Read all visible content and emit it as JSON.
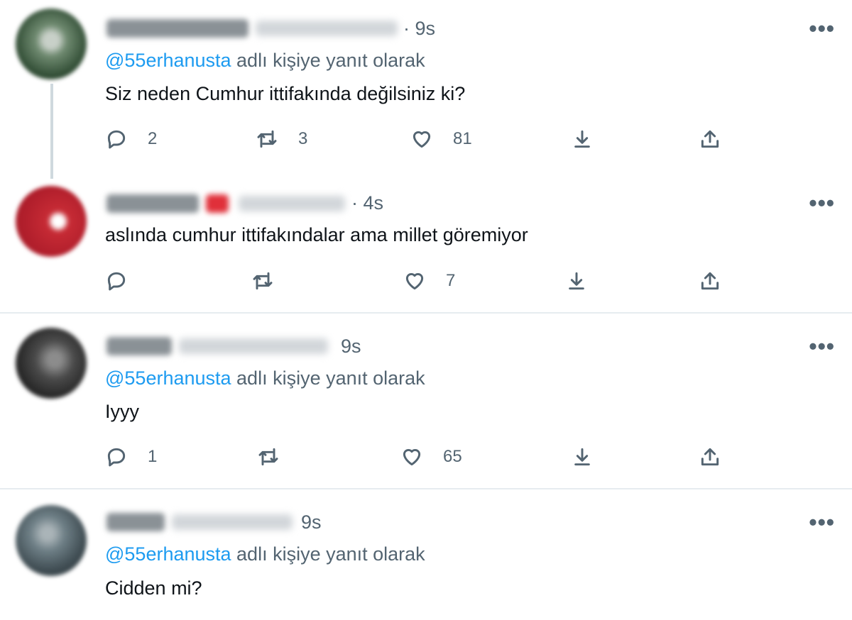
{
  "more_label": "•••",
  "icons": {
    "reply": "reply-icon",
    "retweet": "retweet-icon",
    "like": "like-icon",
    "download": "download-icon",
    "share": "share-icon"
  },
  "colors": {
    "mention": "#1d9bf0",
    "secondary": "#536471",
    "divider": "#e6ecf0"
  },
  "tweets": [
    {
      "time": "· 9s",
      "reply_prefix": "@55erhanusta",
      "reply_suffix": " adlı kişiye yanıt olarak",
      "text": "Siz neden Cumhur ittifakında değilsiniz ki?",
      "replies": "2",
      "retweets": "3",
      "likes": "81"
    },
    {
      "time": "· 4s",
      "reply_prefix": "",
      "reply_suffix": "",
      "text": "aslında cumhur ittifakındalar ama millet göremiyor",
      "replies": "",
      "retweets": "",
      "likes": "7"
    },
    {
      "time": "9s",
      "reply_prefix": "@55erhanusta",
      "reply_suffix": " adlı kişiye yanıt olarak",
      "text": "Iyyy",
      "replies": "1",
      "retweets": "",
      "likes": "65"
    },
    {
      "time": "9s",
      "reply_prefix": "@55erhanusta",
      "reply_suffix": " adlı kişiye yanıt olarak",
      "text": "Cidden mi?",
      "replies": "",
      "retweets": "",
      "likes": ""
    }
  ]
}
